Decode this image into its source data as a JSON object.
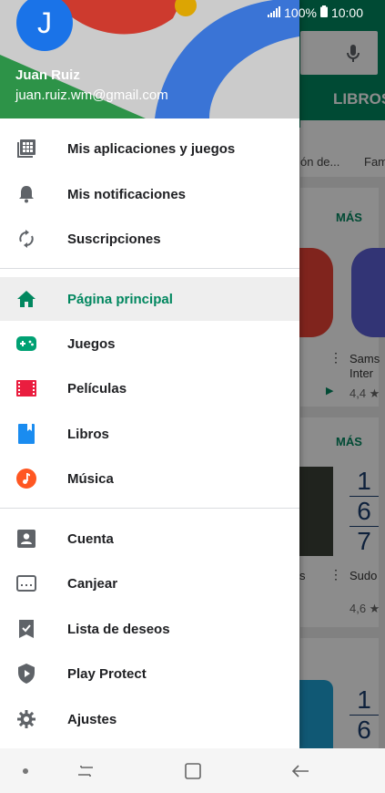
{
  "status_bar": {
    "battery": "100%",
    "time": "10:00"
  },
  "background": {
    "tab_label": "LIBROS",
    "strip_text_1": "ón de...",
    "strip_text_2": "Fam",
    "more_label_1": "MÁS",
    "more_label_2": "MÁS",
    "app_name_1": "Sams",
    "app_name_2": "Inter",
    "rating_1": "4,4 ★",
    "app_name_3": "Sudo",
    "s_letter": "s",
    "rating_2": "4,6 ★",
    "num1": "1",
    "num2": "6",
    "num3": "7",
    "num4": "1",
    "num5": "6"
  },
  "account": {
    "initial": "J",
    "name": "Juan Ruiz",
    "email": "juan.ruiz.wm@gmail.com"
  },
  "menu": {
    "section1": [
      {
        "label": "Mis aplicaciones y juegos",
        "icon": "apps-grid-icon"
      },
      {
        "label": "Mis notificaciones",
        "icon": "bell-icon"
      },
      {
        "label": "Suscripciones",
        "icon": "refresh-icon"
      }
    ],
    "section2": [
      {
        "label": "Página principal",
        "icon": "home-icon",
        "active": true
      },
      {
        "label": "Juegos",
        "icon": "gamepad-icon"
      },
      {
        "label": "Películas",
        "icon": "film-icon"
      },
      {
        "label": "Libros",
        "icon": "book-icon"
      },
      {
        "label": "Música",
        "icon": "music-icon"
      }
    ],
    "section3": [
      {
        "label": "Cuenta",
        "icon": "account-icon"
      },
      {
        "label": "Canjear",
        "icon": "redeem-icon"
      },
      {
        "label": "Lista de deseos",
        "icon": "wishlist-icon"
      },
      {
        "label": "Play Protect",
        "icon": "shield-icon"
      },
      {
        "label": "Ajustes",
        "icon": "gear-icon"
      }
    ]
  },
  "colors": {
    "accent_green": "#01875f",
    "games": "#00a173",
    "movies": "#ea1d3f",
    "books": "#1a8cf0",
    "music": "#ff5722"
  }
}
